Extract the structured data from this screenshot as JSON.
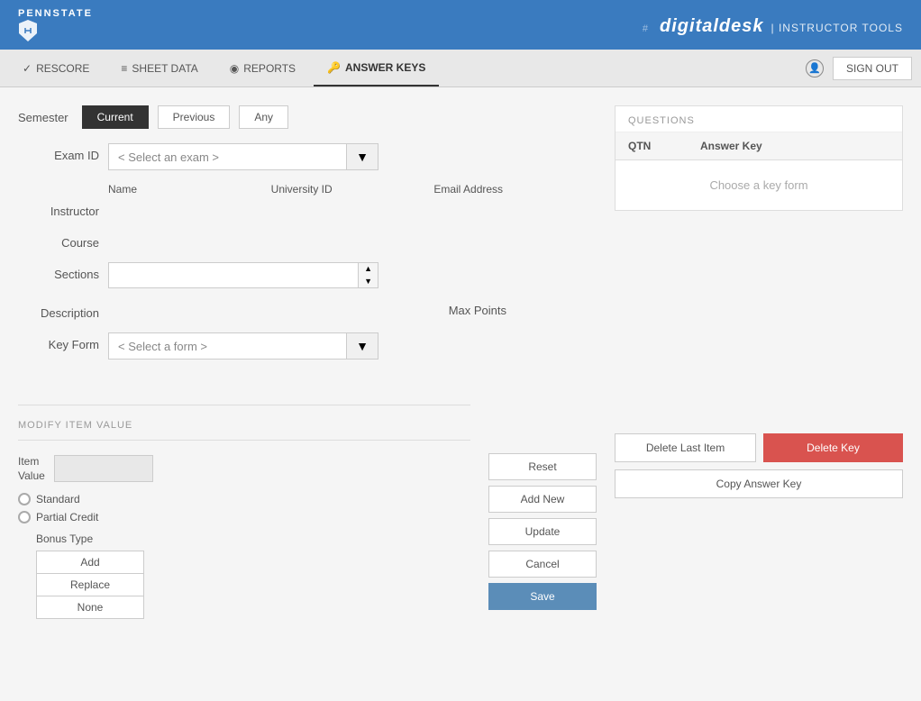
{
  "app": {
    "brand_name": "#digitaldesk",
    "brand_sub": "| INSTRUCTOR TOOLS",
    "logo_shield": "shield"
  },
  "nav": {
    "tabs": [
      {
        "id": "rescore",
        "label": "RESCORE",
        "icon": "✓",
        "active": false
      },
      {
        "id": "sheet-data",
        "label": "SHEET DATA",
        "icon": "≡",
        "active": false
      },
      {
        "id": "reports",
        "label": "REPORTS",
        "icon": "◉",
        "active": false
      },
      {
        "id": "answer-keys",
        "label": "ANSWER KEYS",
        "icon": "🔑",
        "active": true
      }
    ],
    "sign_out_label": "SIGN OUT"
  },
  "semester": {
    "label": "Semester",
    "buttons": [
      {
        "id": "current",
        "label": "Current",
        "active": true
      },
      {
        "id": "previous",
        "label": "Previous",
        "active": false
      },
      {
        "id": "any",
        "label": "Any",
        "active": false
      }
    ]
  },
  "exam_id": {
    "label": "Exam ID",
    "placeholder": "< Select an exam >"
  },
  "instructor_table": {
    "columns": [
      "Name",
      "University ID",
      "Email Address"
    ],
    "label": "Instructor"
  },
  "course": {
    "label": "Course"
  },
  "sections": {
    "label": "Sections"
  },
  "description": {
    "label": "Description"
  },
  "max_points": {
    "label": "Max Points"
  },
  "key_form": {
    "label": "Key Form",
    "placeholder": "< Select a form >"
  },
  "modify_item": {
    "section_title": "MODIFY ITEM VALUE",
    "item_label": "Item",
    "value_label": "Value",
    "radio_options": [
      {
        "id": "standard",
        "label": "Standard"
      },
      {
        "id": "partial-credit",
        "label": "Partial Credit"
      }
    ],
    "bonus_type_label": "Bonus Type",
    "bonus_buttons": [
      "Add",
      "Replace",
      "None"
    ]
  },
  "center_buttons": {
    "reset": "Reset",
    "add_new": "Add New",
    "update": "Update",
    "cancel": "Cancel",
    "save": "Save"
  },
  "right_buttons": {
    "delete_last_item": "Delete Last Item",
    "delete_key": "Delete Key",
    "copy_answer_key": "Copy Answer Key"
  },
  "questions": {
    "title": "QUESTIONS",
    "col_qtn": "QTN",
    "col_answer_key": "Answer Key",
    "empty_message": "Choose a key form"
  },
  "colors": {
    "header_bg": "#3a7bbf",
    "active_tab_bg": "#333333",
    "delete_key_bg": "#d9534f",
    "save_bg": "#5b8db8"
  }
}
